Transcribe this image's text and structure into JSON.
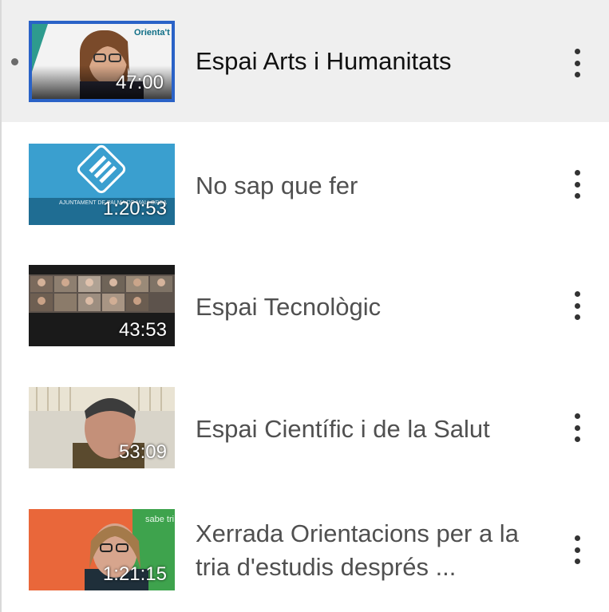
{
  "playlist": {
    "items": [
      {
        "title": "Espai Arts i Humanitats",
        "duration": "47:00",
        "now_playing": true,
        "brand_text": "Orienta't"
      },
      {
        "title": "No sap que fer",
        "duration": "1:20:53",
        "now_playing": false,
        "caption": "AJUNTAMENT DE PALMA DE MALLORCA"
      },
      {
        "title": "Espai Tecnològic",
        "duration": "43:53",
        "now_playing": false
      },
      {
        "title": "Espai Científic i de la Salut",
        "duration": "53:09",
        "now_playing": false
      },
      {
        "title": "Xerrada Orientacions per a la tria d'estudis després ...",
        "duration": "1:21:15",
        "now_playing": false,
        "sign_text": "sabe tri te"
      }
    ]
  },
  "colors": {
    "active_row": "#efefef",
    "selected_border": "#2a62c7",
    "title": "#505050"
  },
  "icons": {
    "more": "vertical-ellipsis-icon",
    "now_playing": "dot-icon"
  }
}
